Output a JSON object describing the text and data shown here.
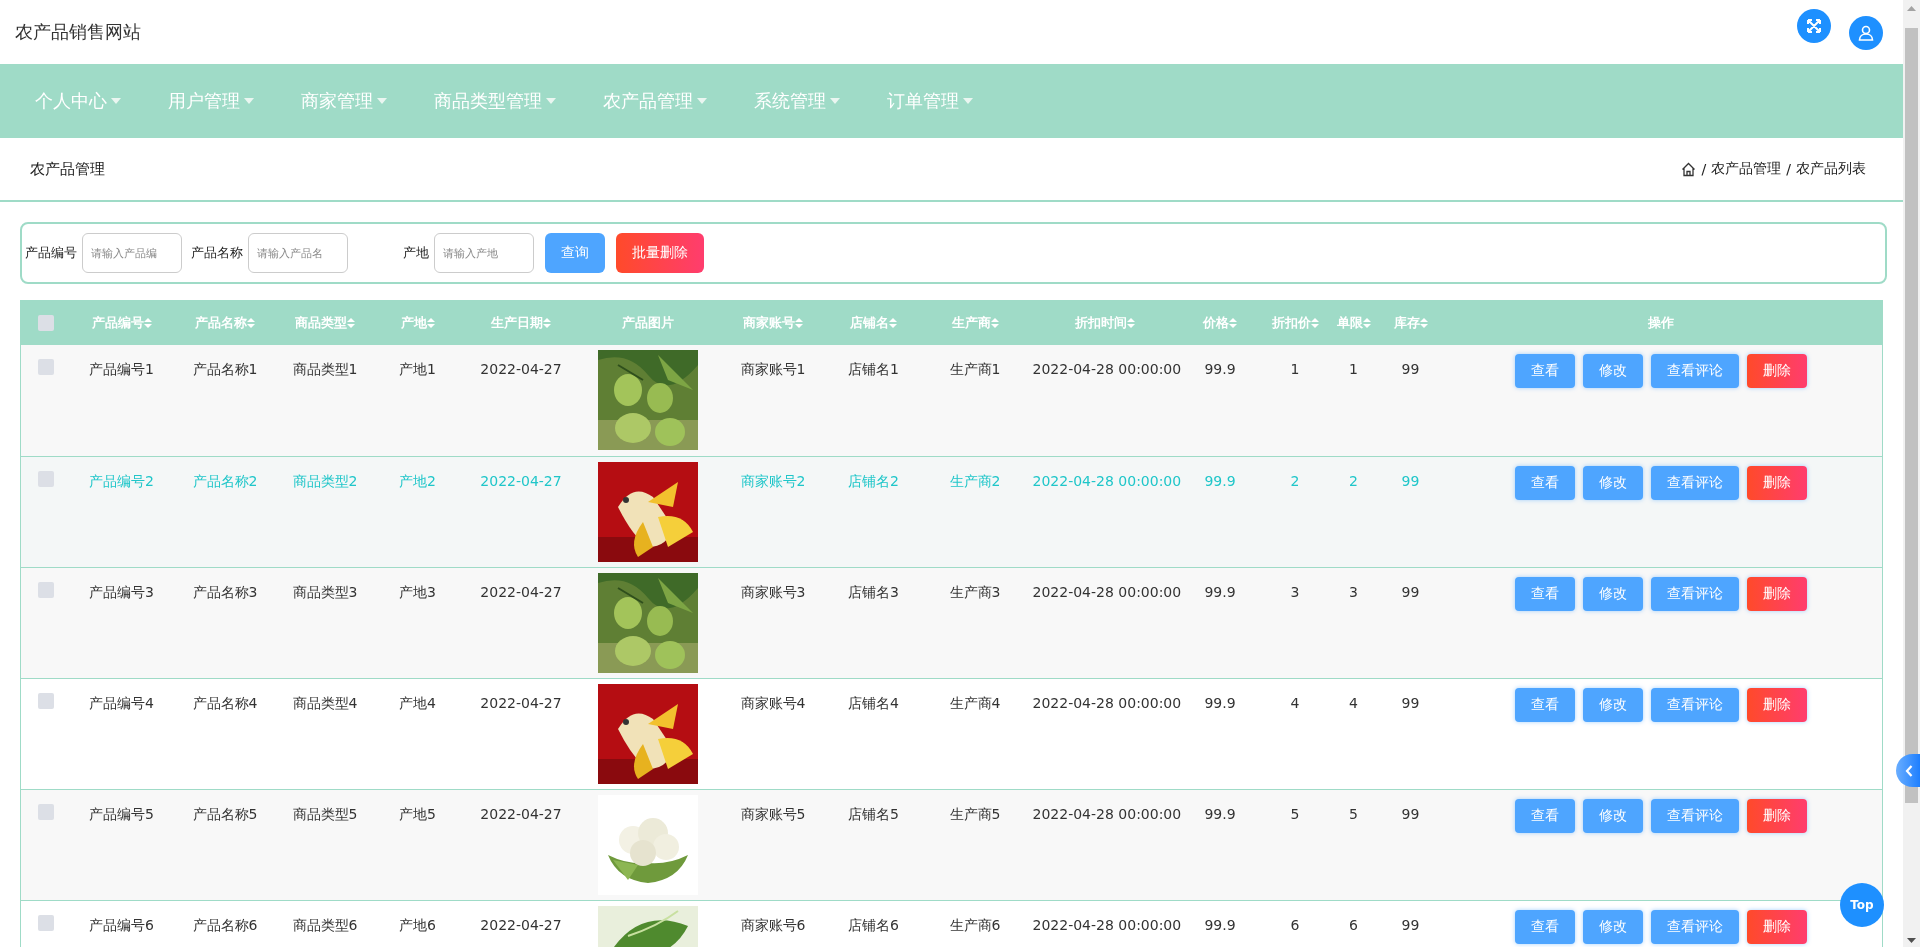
{
  "site_title": "农产品销售网站",
  "nav": [
    {
      "label": "个人中心"
    },
    {
      "label": "用户管理"
    },
    {
      "label": "商家管理"
    },
    {
      "label": "商品类型管理"
    },
    {
      "label": "农产品管理"
    },
    {
      "label": "系统管理"
    },
    {
      "label": "订单管理"
    }
  ],
  "page_title": "农产品管理",
  "breadcrumb": [
    {
      "separator": "/",
      "label": "农产品管理"
    },
    {
      "separator": "/",
      "label": "农产品列表"
    }
  ],
  "search": {
    "fields": [
      {
        "label": "产品编号",
        "placeholder": "请输入产品编"
      },
      {
        "label": "产品名称",
        "placeholder": "请输入产品名"
      },
      {
        "label": "产地",
        "placeholder": "请输入产地"
      }
    ],
    "buttons": [
      {
        "label": "查询",
        "kind": "primary"
      },
      {
        "label": "批量删除",
        "kind": "danger"
      }
    ]
  },
  "table": {
    "select_all": {
      "checked": false
    },
    "columns": [
      {
        "label": "产品编号",
        "sortable": true
      },
      {
        "label": "产品名称",
        "sortable": true
      },
      {
        "label": "商品类型",
        "sortable": true
      },
      {
        "label": "产地",
        "sortable": true
      },
      {
        "label": "生产日期",
        "sortable": true
      },
      {
        "label": "产品图片",
        "sortable": false
      },
      {
        "label": "商家账号",
        "sortable": true
      },
      {
        "label": "店铺名",
        "sortable": true
      },
      {
        "label": "生产商",
        "sortable": true
      },
      {
        "label": "折扣时间",
        "sortable": true
      },
      {
        "label": "价格",
        "sortable": true
      },
      {
        "label": "折扣价",
        "sortable": true
      },
      {
        "label": "单限",
        "sortable": true
      },
      {
        "label": "库存",
        "sortable": true
      },
      {
        "label": "操作",
        "sortable": false
      }
    ],
    "rows": [
      {
        "checked": false,
        "highlighted": false,
        "code": "产品编号1",
        "name": "产品名称1",
        "category": "商品类型1",
        "origin": "产地1",
        "production_date": "2022-04-27",
        "merchant_account": "商家账号1",
        "shop_name": "店铺名1",
        "producer": "生产商1",
        "discount_time": "2022-04-28 00:00:00",
        "price": "99.9",
        "discount_price": "1",
        "limit": "1",
        "stock": "99",
        "actions": [
          {
            "label": "查看",
            "kind": "primary"
          },
          {
            "label": "修改",
            "kind": "primary"
          },
          {
            "label": "查看评论",
            "kind": "primary"
          },
          {
            "label": "删除",
            "kind": "danger"
          }
        ]
      },
      {
        "checked": false,
        "highlighted": true,
        "code": "产品编号2",
        "name": "产品名称2",
        "category": "商品类型2",
        "origin": "产地2",
        "production_date": "2022-04-27",
        "merchant_account": "商家账号2",
        "shop_name": "店铺名2",
        "producer": "生产商2",
        "discount_time": "2022-04-28 00:00:00",
        "price": "99.9",
        "discount_price": "2",
        "limit": "2",
        "stock": "99",
        "actions": [
          {
            "label": "查看",
            "kind": "primary"
          },
          {
            "label": "修改",
            "kind": "primary"
          },
          {
            "label": "查看评论",
            "kind": "primary"
          },
          {
            "label": "删除",
            "kind": "danger"
          }
        ]
      },
      {
        "checked": false,
        "highlighted": false,
        "code": "产品编号3",
        "name": "产品名称3",
        "category": "商品类型3",
        "origin": "产地3",
        "production_date": "2022-04-27",
        "merchant_account": "商家账号3",
        "shop_name": "店铺名3",
        "producer": "生产商3",
        "discount_time": "2022-04-28 00:00:00",
        "price": "99.9",
        "discount_price": "3",
        "limit": "3",
        "stock": "99",
        "actions": [
          {
            "label": "查看",
            "kind": "primary"
          },
          {
            "label": "修改",
            "kind": "primary"
          },
          {
            "label": "查看评论",
            "kind": "primary"
          },
          {
            "label": "删除",
            "kind": "danger"
          }
        ]
      },
      {
        "checked": false,
        "highlighted": false,
        "code": "产品编号4",
        "name": "产品名称4",
        "category": "商品类型4",
        "origin": "产地4",
        "production_date": "2022-04-27",
        "merchant_account": "商家账号4",
        "shop_name": "店铺名4",
        "producer": "生产商4",
        "discount_time": "2022-04-28 00:00:00",
        "price": "99.9",
        "discount_price": "4",
        "limit": "4",
        "stock": "99",
        "actions": [
          {
            "label": "查看",
            "kind": "primary"
          },
          {
            "label": "修改",
            "kind": "primary"
          },
          {
            "label": "查看评论",
            "kind": "primary"
          },
          {
            "label": "删除",
            "kind": "danger"
          }
        ]
      },
      {
        "checked": false,
        "highlighted": false,
        "code": "产品编号5",
        "name": "产品名称5",
        "category": "商品类型5",
        "origin": "产地5",
        "production_date": "2022-04-27",
        "merchant_account": "商家账号5",
        "shop_name": "店铺名5",
        "producer": "生产商5",
        "discount_time": "2022-04-28 00:00:00",
        "price": "99.9",
        "discount_price": "5",
        "limit": "5",
        "stock": "99",
        "actions": [
          {
            "label": "查看",
            "kind": "primary"
          },
          {
            "label": "修改",
            "kind": "primary"
          },
          {
            "label": "查看评论",
            "kind": "primary"
          },
          {
            "label": "删除",
            "kind": "danger"
          }
        ]
      },
      {
        "checked": false,
        "highlighted": false,
        "code": "产品编号6",
        "name": "产品名称6",
        "category": "商品类型6",
        "origin": "产地6",
        "production_date": "2022-04-27",
        "merchant_account": "商家账号6",
        "shop_name": "店铺名6",
        "producer": "生产商6",
        "discount_time": "2022-04-28 00:00:00",
        "price": "99.9",
        "discount_price": "6",
        "limit": "6",
        "stock": "99",
        "actions": [
          {
            "label": "查看",
            "kind": "primary"
          },
          {
            "label": "修改",
            "kind": "primary"
          },
          {
            "label": "查看评论",
            "kind": "primary"
          },
          {
            "label": "删除",
            "kind": "danger"
          }
        ]
      }
    ]
  },
  "back_to_top": {
    "label": "Top"
  }
}
